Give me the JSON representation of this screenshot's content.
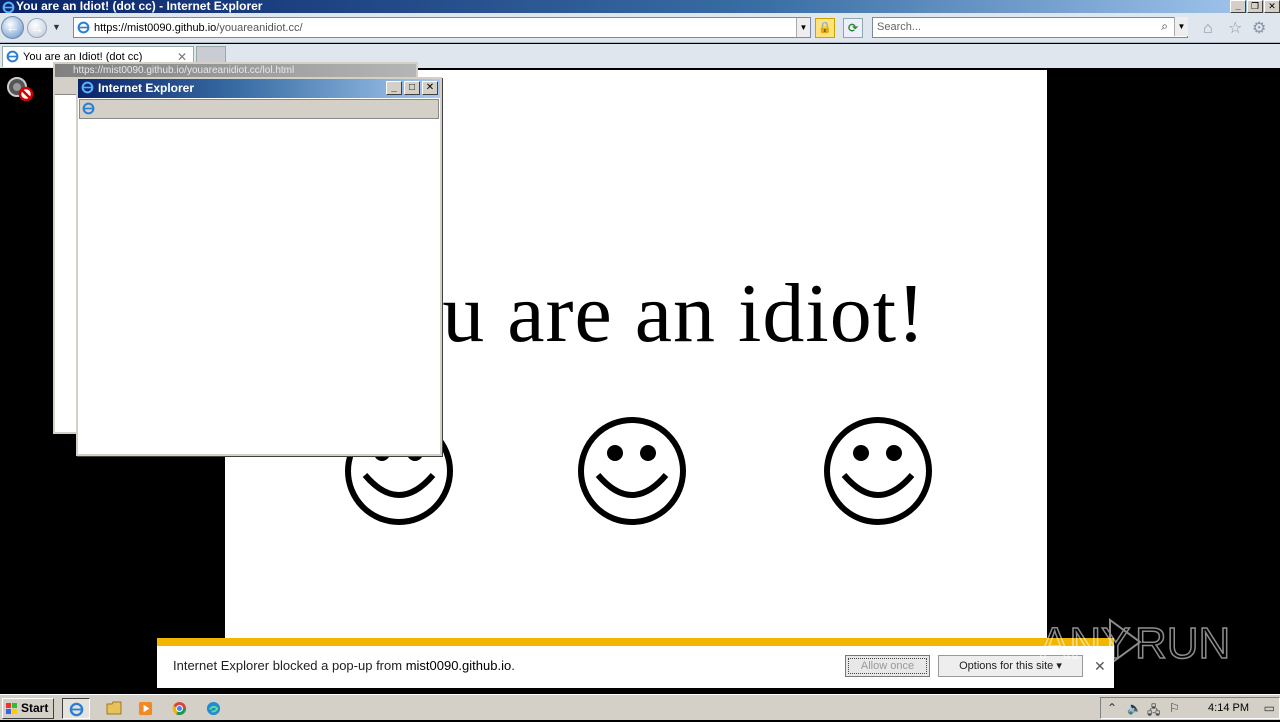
{
  "window": {
    "title": "You are an Idiot! (dot cc) - Internet Explorer"
  },
  "toolbar": {
    "url_host": "https://mist0090.github.io",
    "url_path": "/youareanidiot.cc/",
    "search_placeholder": "Search..."
  },
  "tabs": [
    {
      "label": "You are an Idiot! (dot cc)"
    }
  ],
  "page": {
    "headline": "You are an idiot!"
  },
  "popups": {
    "back_title": "https://mist0090.github.io/youareanidiot.cc/lol.html",
    "front_title": "Internet Explorer"
  },
  "notification": {
    "text_prefix": "Internet Explorer blocked a pop-up from ",
    "domain": "mist0090.github.io",
    "text_suffix": ".",
    "allow_label": "Allow once",
    "options_label": "Options for this site"
  },
  "watermark": {
    "left": "ANY",
    "right": "RUN"
  },
  "taskbar": {
    "start_label": "Start",
    "clock": "4:14 PM"
  },
  "colors": {
    "notification_accent": "#f2b600",
    "titlebar_dark": "#0a246a"
  }
}
